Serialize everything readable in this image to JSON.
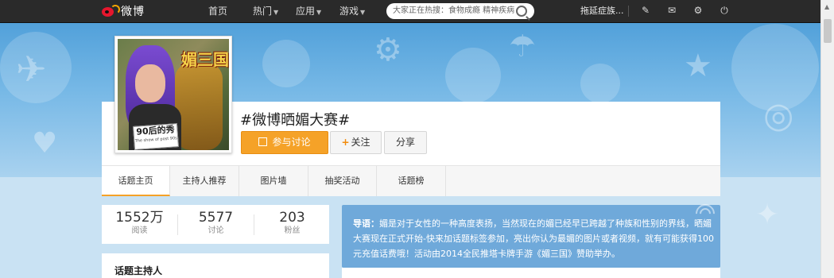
{
  "nav": {
    "logo_text": "微博",
    "items": [
      {
        "label": "首页",
        "has_caret": false
      },
      {
        "label": "热门",
        "has_caret": true
      },
      {
        "label": "应用",
        "has_caret": true
      },
      {
        "label": "游戏",
        "has_caret": true
      }
    ],
    "search_placeholder": "大家正在热搜：食物成瘾 精神疾病",
    "user_name": "拖延症族..."
  },
  "avatar": {
    "game_logo": "媚三国",
    "sign_title": "90后的秀",
    "sign_sub": "The show of post 90s"
  },
  "topic": {
    "title": "#微博晒媚大赛#",
    "join_label": "参与讨论",
    "follow_label": "关注",
    "share_label": "分享"
  },
  "tabs": [
    {
      "label": "话题主页",
      "active": true
    },
    {
      "label": "主持人推荐",
      "active": false
    },
    {
      "label": "图片墙",
      "active": false
    },
    {
      "label": "抽奖活动",
      "active": false
    },
    {
      "label": "话题榜",
      "active": false
    }
  ],
  "stats": [
    {
      "value": "1552万",
      "label": "阅读"
    },
    {
      "value": "5577",
      "label": "讨论"
    },
    {
      "value": "203",
      "label": "粉丝"
    }
  ],
  "host_title": "话题主持人",
  "intro": {
    "prefix": "导语：",
    "text": "媚是对于女性的一种高度表扬，当然现在的媚已经早已跨越了种族和性别的界线，晒媚大赛现在正式开始-快来加话题标签参加，亮出你认为最媚的图片或者视频，就有可能获得100元充值话费哦！活动由2014全民推塔卡牌手游《媚三国》赞助举办。"
  },
  "colors": {
    "accent": "#f5a228",
    "nav_bg": "#2a2a2a",
    "intro_bg": "#6fa9da"
  }
}
